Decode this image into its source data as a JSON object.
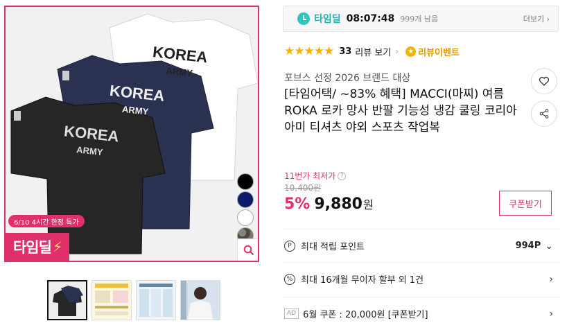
{
  "gallery": {
    "timedeal_logo": "타임딜",
    "limit_badge": "6/10 4시간 한정 특가",
    "shirt_text_top": "KOREA",
    "shirt_text_bottom": "ARMY",
    "swatches": [
      "#000000",
      "#0b1a6b",
      "#ffffff",
      "#6a645e"
    ],
    "accent": "#e0306c"
  },
  "timedeal": {
    "label": "타임딜",
    "time": "08:07:48",
    "remaining": "999개 남음",
    "more": "더보기"
  },
  "rating": {
    "stars": "★★★★★",
    "count": "33",
    "review_link": "리뷰 보기",
    "event_label": "리뷰이벤트"
  },
  "product": {
    "brand_line": "포브스 선정 2026 브랜드 대상",
    "title": "[타임어택/ ~83% 혜택] MACCI(마찌) 여름 ROKA 로카 망사 반팔 기능성 냉감 쿨링 코리아 아미 티셔츠 야외 스포츠 작업복"
  },
  "price": {
    "lowest_label": "11번가 최저가",
    "original": "10,400원",
    "discount": "5%",
    "amount": "9,880",
    "unit": "원",
    "coupon_button": "쿠폰받기"
  },
  "rows": {
    "points_label": "최대 적립 포인트",
    "points_value": "994P",
    "installment_label": "최대 16개월 무이자 할부 외 1건",
    "ad_tag": "AD",
    "coupon_label": "6월 쿠폰 : 20,000원 [쿠폰받기]"
  }
}
